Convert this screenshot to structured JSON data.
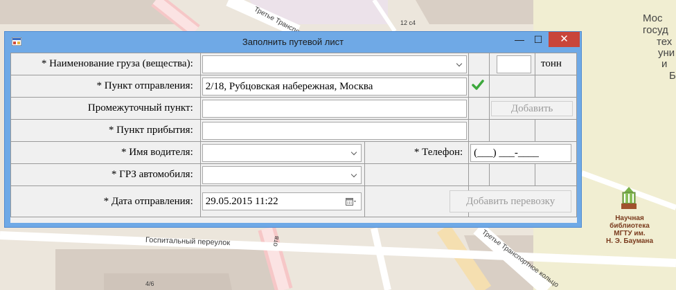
{
  "map": {
    "building_number_top": "12 с4",
    "street_top": "Третье Транспортное",
    "street_bottom_left": "Госпитальный переулок",
    "street_bottom_right": "Третье Транспортное кольцо",
    "street_vertical": "отв",
    "building_number_bottom": "4/6",
    "right_edge_text": [
      "Мос",
      "госуд",
      "тех",
      "уни",
      "и",
      "Б"
    ],
    "library_label": [
      "Научная",
      "библиотека",
      "МГТУ им.",
      "Н. Э. Баумана"
    ]
  },
  "window": {
    "title": "Заполнить путевой лист",
    "minimize": "—",
    "maximize": "☐",
    "close": "✕"
  },
  "form": {
    "cargo_label": "* Наименование груза (вещества):",
    "cargo_value": "",
    "quantity_value": "",
    "quantity_unit": "тонн",
    "departure_label": "* Пункт отправления:",
    "departure_value": "2/18, Рубцовская набережная, Москва",
    "intermediate_label": "Промежуточный пункт:",
    "intermediate_value": "",
    "add_button": "Добавить",
    "arrival_label": "* Пункт прибытия:",
    "arrival_value": "",
    "driver_label": "* Имя водителя:",
    "driver_value": "",
    "phone_label": "* Телефон:",
    "phone_value": "(___) ___-____",
    "plate_label": "* ГРЗ автомобиля:",
    "plate_value": "",
    "date_label": "* Дата отправления:",
    "date_value": "29.05.2015 11:22",
    "add_trip_button": "Добавить перевозку"
  },
  "colors": {
    "titlebar": "#6fa9e6",
    "close_button": "#c9453a",
    "check": "#3ca83c"
  },
  "icons": [
    "app-icon",
    "checkmark-icon",
    "calendar-icon",
    "chevron-down-icon",
    "library-icon"
  ]
}
